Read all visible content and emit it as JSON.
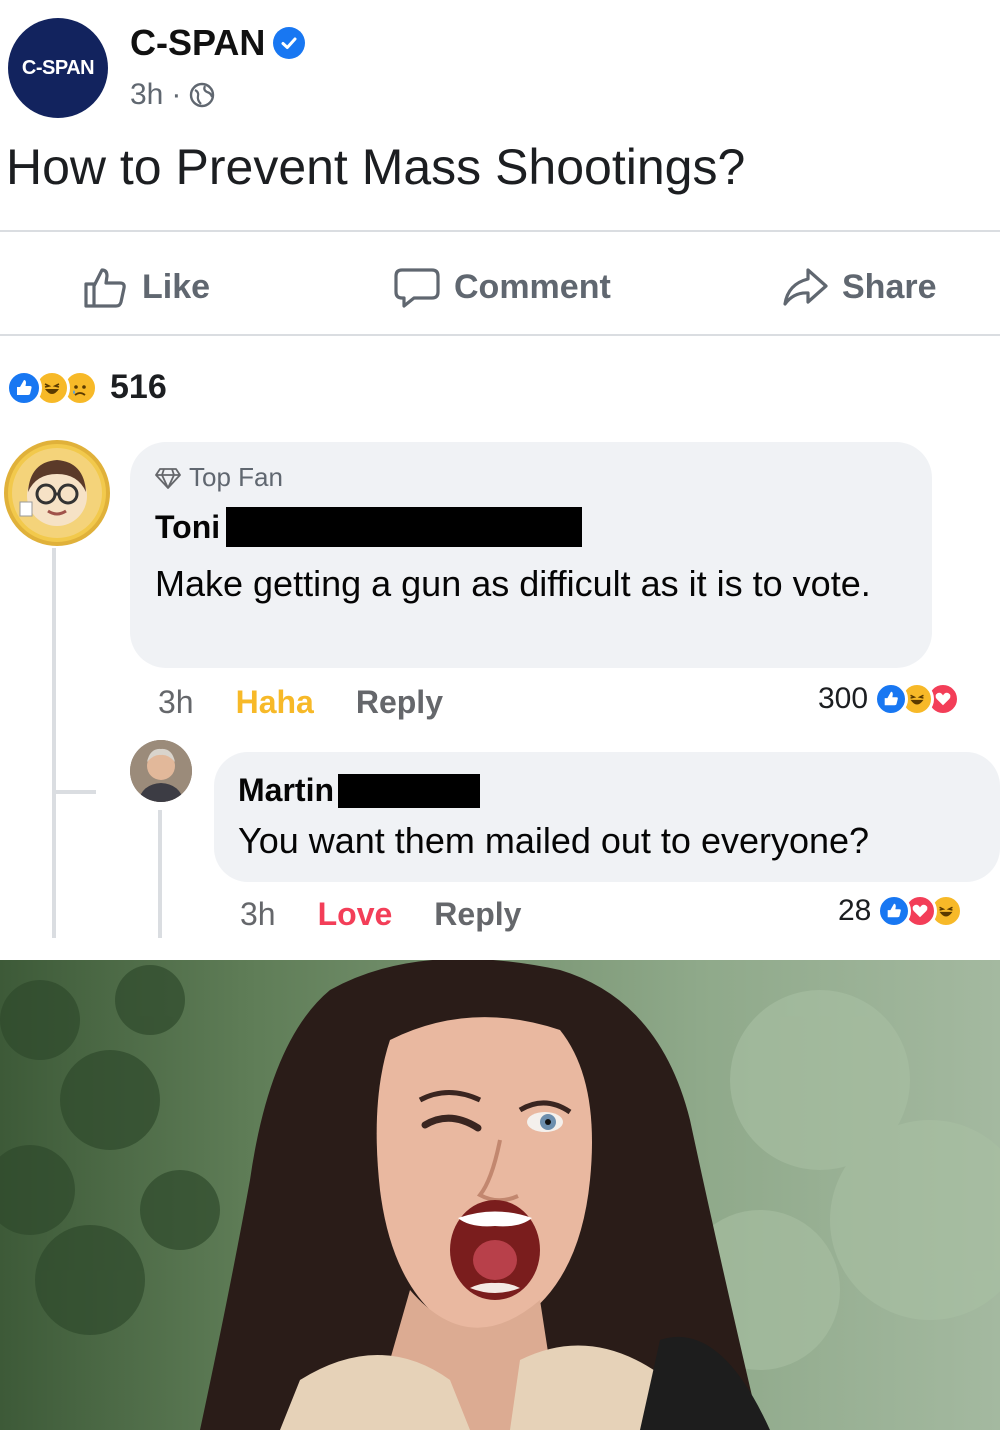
{
  "post": {
    "page_logo_text": "C-SPAN",
    "page_name": "C-SPAN",
    "time": "3h",
    "meta_separator": "·",
    "text": "How to Prevent Mass Shootings?"
  },
  "actions": {
    "like": "Like",
    "comment": "Comment",
    "share": "Share"
  },
  "reactions": {
    "count": "516",
    "icons": [
      "like",
      "haha",
      "sad"
    ]
  },
  "comments": [
    {
      "badge": "Top Fan",
      "author": "Toni",
      "text": "Make getting a gun as difficult as it is to vote.",
      "time": "3h",
      "my_reaction": "Haha",
      "reply": "Reply",
      "reaction_count": "300",
      "reaction_icons": [
        "like",
        "haha",
        "love"
      ]
    },
    {
      "author": "Martin",
      "text": "You want them mailed out to everyone?",
      "time": "3h",
      "my_reaction": "Love",
      "reply": "Reply",
      "reaction_count": "28",
      "reaction_icons": [
        "like",
        "love",
        "haha"
      ]
    }
  ],
  "colors": {
    "facebook_blue": "#1877f2",
    "haha_orange": "#f7b928",
    "love_red": "#f33e58",
    "cspan_navy": "#12235e",
    "bubble_gray": "#f0f2f5"
  }
}
